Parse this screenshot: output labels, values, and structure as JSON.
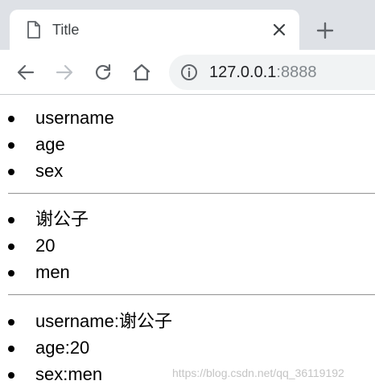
{
  "browser": {
    "tab": {
      "title": "Title",
      "icon": "page-icon"
    },
    "toolbar": {
      "back_icon": "back-arrow-icon",
      "forward_icon": "forward-arrow-icon",
      "reload_icon": "reload-icon",
      "home_icon": "home-icon"
    },
    "address": {
      "host": "127.0.0.1",
      "port": ":8888"
    }
  },
  "page": {
    "keys_list": [
      "username",
      "age",
      "sex"
    ],
    "values_list": [
      "谢公子",
      "20",
      "men"
    ],
    "pairs_list": [
      "username:谢公子",
      "age:20",
      "sex:men"
    ],
    "watermark": "https://blog.csdn.net/qq_36119192"
  }
}
